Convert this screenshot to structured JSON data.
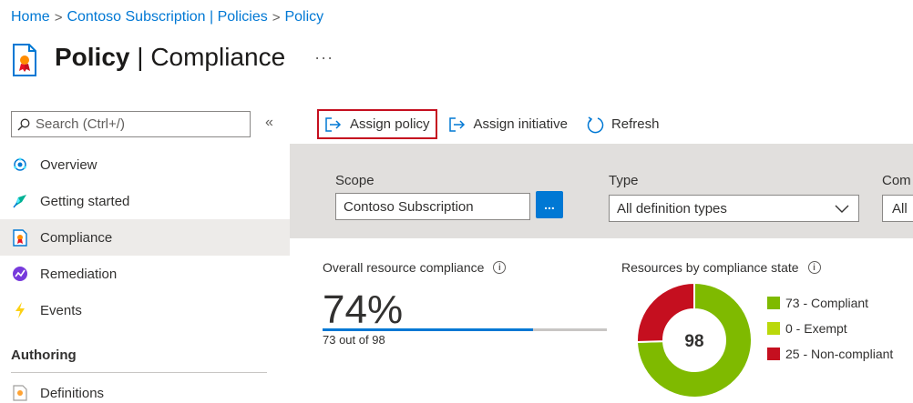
{
  "breadcrumb": {
    "items": [
      "Home",
      "Contoso Subscription | Policies",
      "Policy"
    ],
    "separator": ">"
  },
  "header": {
    "title_bold": "Policy",
    "title_rest": " | Compliance",
    "more": "···"
  },
  "sidebar": {
    "search_placeholder": "Search (Ctrl+/)",
    "collapse": "«",
    "items": [
      {
        "label": "Overview",
        "icon": "overview-icon"
      },
      {
        "label": "Getting started",
        "icon": "getting-started-icon"
      },
      {
        "label": "Compliance",
        "icon": "compliance-icon",
        "active": true
      },
      {
        "label": "Remediation",
        "icon": "remediation-icon"
      },
      {
        "label": "Events",
        "icon": "events-icon"
      }
    ],
    "section": "Authoring",
    "section_items": [
      {
        "label": "Definitions",
        "icon": "definitions-icon"
      }
    ]
  },
  "toolbar": {
    "assign_policy": "Assign policy",
    "assign_initiative": "Assign initiative",
    "refresh": "Refresh"
  },
  "filters": {
    "scope_label": "Scope",
    "scope_value": "Contoso Subscription",
    "scope_button": "...",
    "type_label": "Type",
    "type_value": "All definition types",
    "third_label": "Com",
    "third_value": "All"
  },
  "overall": {
    "title": "Overall resource compliance",
    "percent_text": "74%",
    "percent": 74,
    "subtitle": "73 out of 98"
  },
  "by_state": {
    "title": "Resources by compliance state",
    "total": "98",
    "legend": [
      {
        "label": "73 - Compliant",
        "value": 73,
        "color": "#7fba00"
      },
      {
        "label": "0 - Exempt",
        "value": 0,
        "color": "#bad80a"
      },
      {
        "label": "25 - Non-compliant",
        "value": 25,
        "color": "#c50f1f"
      }
    ]
  },
  "colors": {
    "link": "#0078d4",
    "accent": "#0078d4",
    "highlight_border": "#c50f1f"
  }
}
